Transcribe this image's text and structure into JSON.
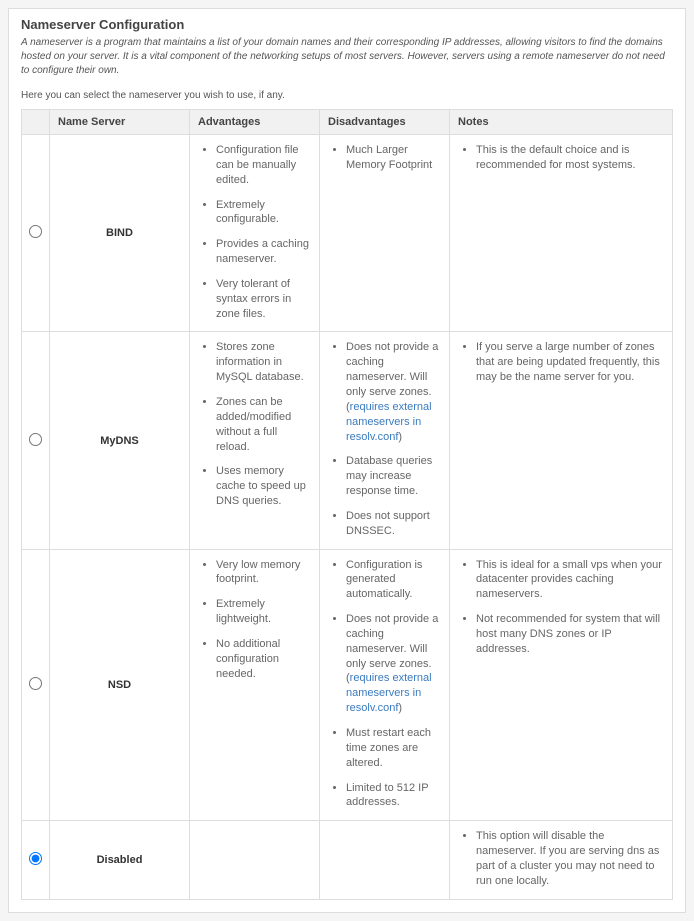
{
  "header": {
    "title": "Nameserver Configuration",
    "intro": "A nameserver is a program that maintains a list of your domain names and their corresponding IP addresses, allowing visitors to find the domains hosted on your server. It is a vital component of the networking setups of most servers. However, servers using a remote nameserver do not need to configure their own.",
    "sub": "Here you can select the nameserver you wish to use, if any."
  },
  "columns": {
    "radio": "",
    "name": "Name Server",
    "advantages": "Advantages",
    "disadvantages": "Disadvantages",
    "notes": "Notes"
  },
  "link_text": "requires external nameservers in resolv.conf",
  "rows": [
    {
      "id": "bind",
      "selected": false,
      "name": "BIND",
      "advantages": [
        "Configuration file can be manually edited.",
        "Extremely configurable.",
        "Provides a caching nameserver.",
        "Very tolerant of syntax errors in zone files."
      ],
      "disadvantages": [
        "Much Larger Memory Footprint"
      ],
      "notes": [
        "This is the default choice and is recommended for most systems."
      ]
    },
    {
      "id": "mydns",
      "selected": false,
      "name": "MyDNS",
      "advantages": [
        "Stores zone information in MySQL database.",
        "Zones can be added/modified without a full reload.",
        "Uses memory cache to speed up DNS queries."
      ],
      "disadvantages": [
        {
          "prefix": "Does not provide a caching nameserver. Will only serve zones. (",
          "link": true,
          "suffix": ")"
        },
        "Database queries may increase response time.",
        "Does not support DNSSEC."
      ],
      "notes": [
        "If you serve a large number of zones that are being updated frequently, this may be the name server for you."
      ]
    },
    {
      "id": "nsd",
      "selected": false,
      "name": "NSD",
      "advantages": [
        "Very low memory footprint.",
        "Extremely lightweight.",
        "No additional configuration needed."
      ],
      "disadvantages": [
        "Configuration is generated automatically.",
        {
          "prefix": "Does not provide a caching nameserver. Will only serve zones. (",
          "link": true,
          "suffix": ")"
        },
        "Must restart each time zones are altered.",
        "Limited to 512 IP addresses."
      ],
      "notes": [
        "This is ideal for a small vps when your datacenter provides caching nameservers.",
        "Not recommended for system that will host many DNS zones or IP addresses."
      ]
    },
    {
      "id": "disabled",
      "selected": true,
      "name": "Disabled",
      "advantages": [],
      "disadvantages": [],
      "notes": [
        "This option will disable the nameserver. If you are serving dns as part of a cluster you may not need to run one locally."
      ]
    }
  ]
}
